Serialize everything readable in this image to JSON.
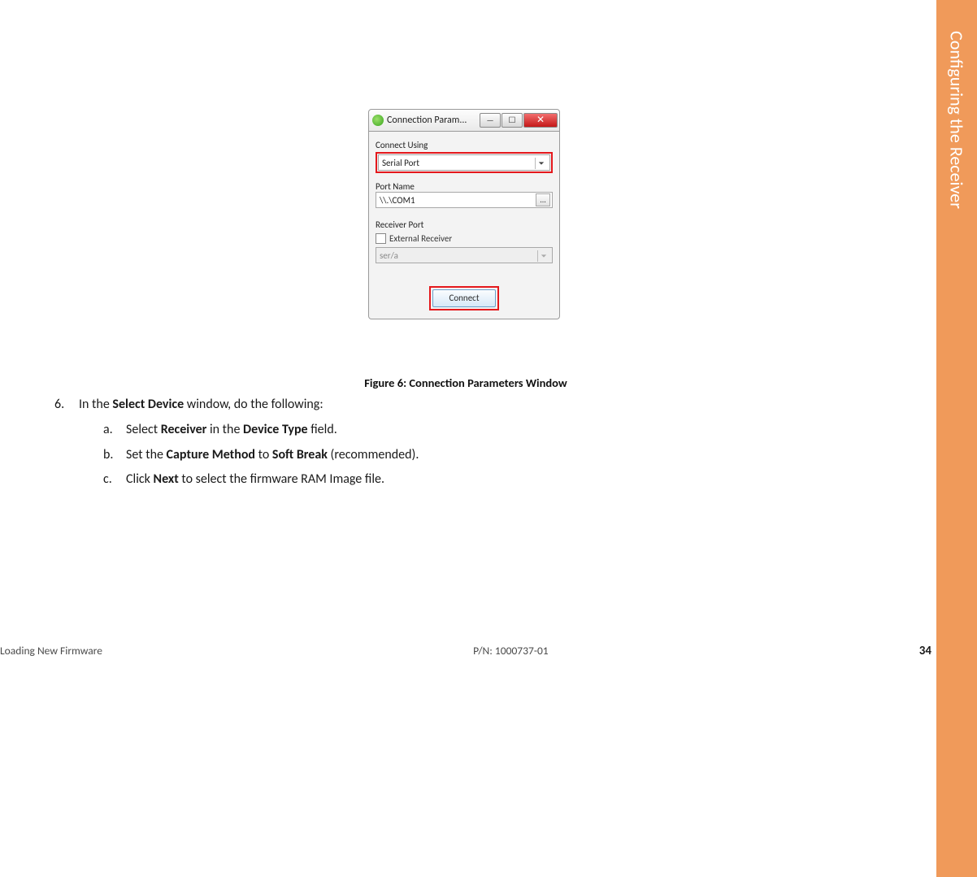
{
  "side_tab": {
    "title": "Configuring the Receiver"
  },
  "dialog": {
    "title": "Connection Param...",
    "connect_using_label": "Connect Using",
    "connect_using_value": "Serial Port",
    "port_name_label": "Port Name",
    "port_name_value": "\\\\.\\COM1",
    "browse_label": "...",
    "receiver_port_label": "Receiver Port",
    "external_receiver_label": "External Receiver",
    "receiver_port_value": "ser/a",
    "connect_button": "Connect",
    "win_min": "—",
    "win_max": "☐",
    "win_close": "✕"
  },
  "figure_caption": "Figure 6: Connection Parameters Window",
  "step": {
    "number": "6.",
    "text_pre": "In the ",
    "text_bold": "Select Device",
    "text_post": " window, do the following:",
    "a": {
      "lbl": "a.",
      "pre": "Select ",
      "b1": "Receiver",
      "mid": " in the ",
      "b2": "Device Type",
      "post": " field."
    },
    "b": {
      "lbl": "b.",
      "pre": "Set the ",
      "b1": "Capture Method",
      "mid": " to ",
      "b2": "Soft Break",
      "post": " (recommended)."
    },
    "c": {
      "lbl": "c.",
      "pre": "Click ",
      "b1": "Next",
      "post": " to select the firmware RAM Image file."
    }
  },
  "footer": {
    "section": "Loading New Firmware",
    "pn": "P/N: 1000737-01",
    "page": "34"
  }
}
